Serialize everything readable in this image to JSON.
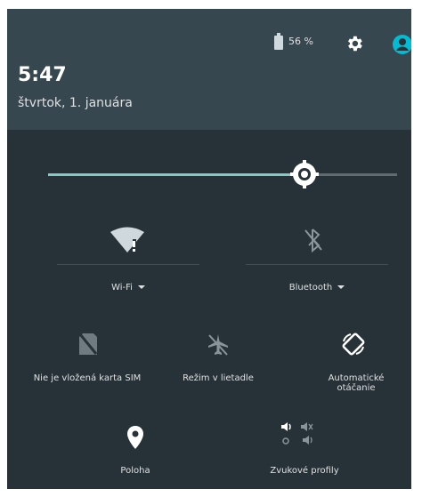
{
  "status_bar": {
    "battery_percent": "56 %",
    "settings_icon": "gear-icon",
    "user_icon": "account-circle-icon"
  },
  "header": {
    "time": "5:47",
    "date": "štvrtok, 1. januára"
  },
  "brightness": {
    "level": 0.72,
    "accent": "#80cbc4"
  },
  "tiles": {
    "wifi": {
      "label": "Wi-Fi"
    },
    "bluetooth": {
      "label": "Bluetooth"
    },
    "sim": {
      "label": "Nie je vložená karta SIM"
    },
    "airplane": {
      "label": "Režim v lietadle"
    },
    "rotation": {
      "label": "Automatické otáčanie"
    },
    "location": {
      "label": "Poloha"
    },
    "sound_profiles": {
      "label": "Zvukové profily"
    }
  }
}
